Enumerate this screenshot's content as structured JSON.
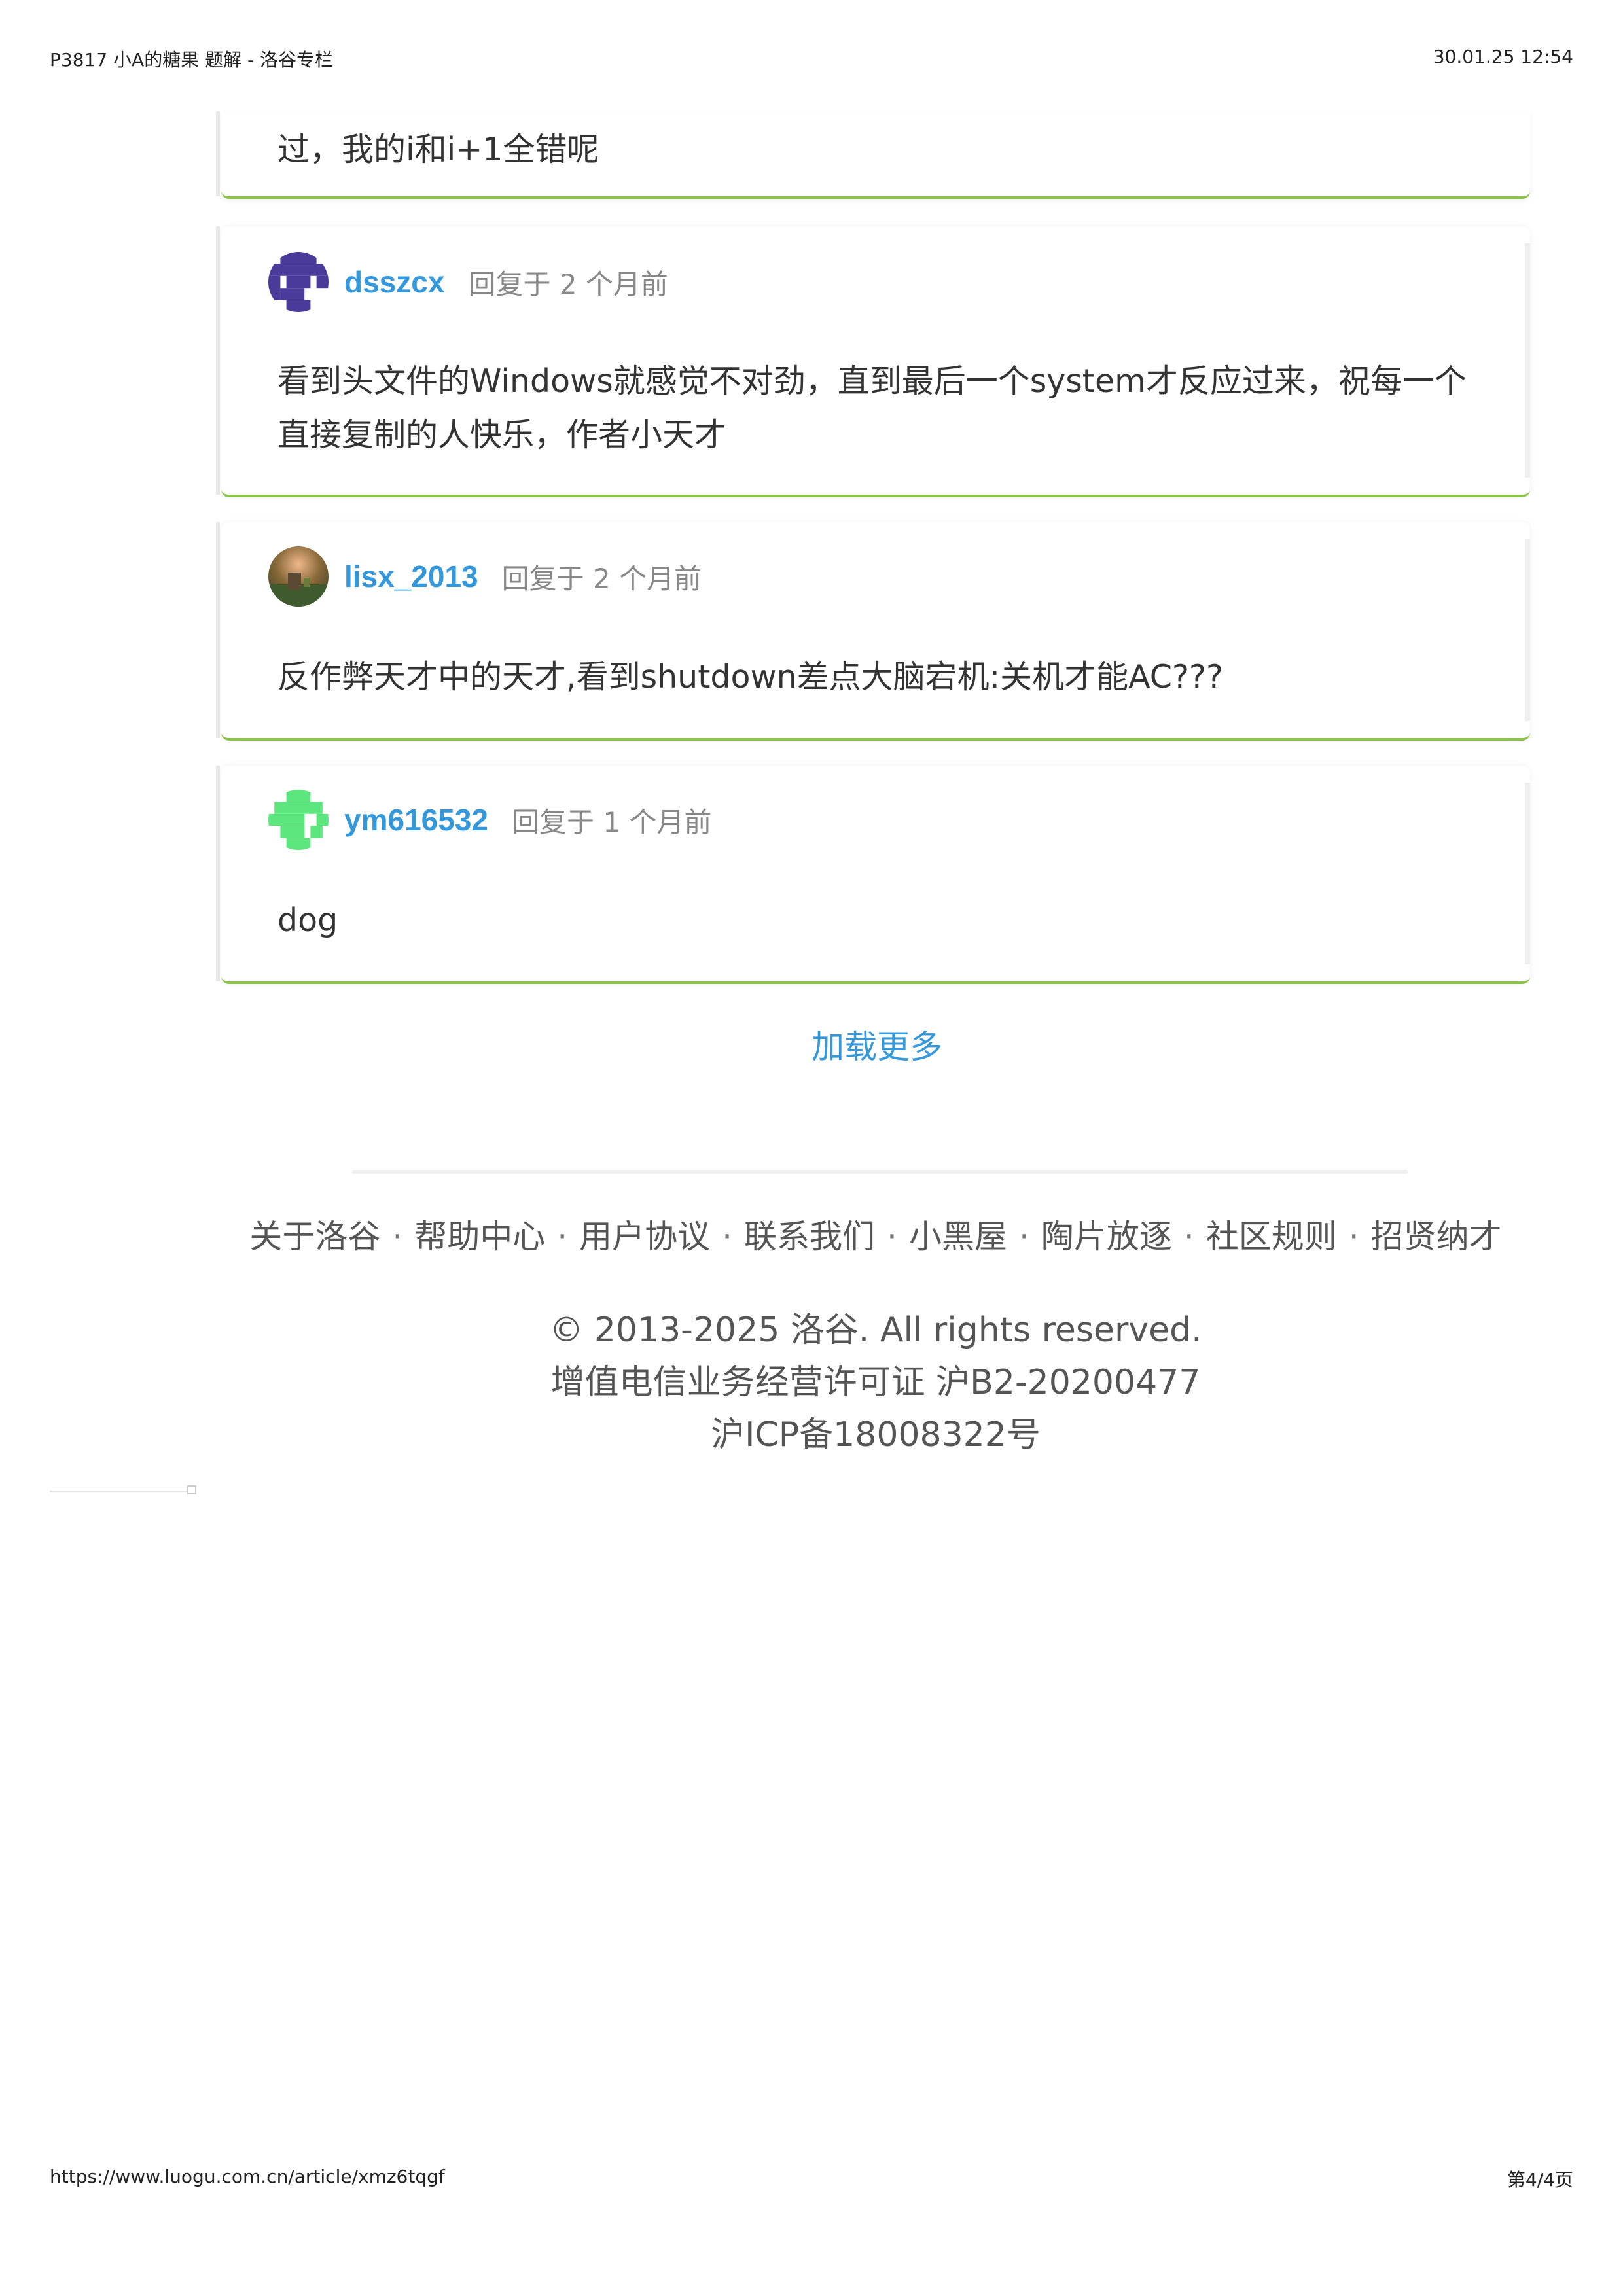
{
  "print_header": {
    "title": "P3817 小A的糖果 题解 - 洛谷专栏",
    "datetime": "30.01.25 12:54"
  },
  "print_footer": {
    "url": "https://www.luogu.com.cn/article/xmz6tqgf",
    "page": "第4/4页"
  },
  "comments": [
    {
      "text": "过，我的i和i+1全错呢"
    },
    {
      "user": "dsszcx",
      "meta": "回复于 2 个月前",
      "text": "看到头文件的Windows就感觉不对劲，直到最后一个system才反应过来，祝每一个直接复制的人快乐，作者小天才"
    },
    {
      "user": "lisx_2013",
      "meta": "回复于 2 个月前",
      "text": "反作弊天才中的天才,看到shutdown差点大脑宕机:关机才能AC???"
    },
    {
      "user": "ym616532",
      "meta": "回复于 1 个月前",
      "text": "dog"
    }
  ],
  "load_more": "加载更多",
  "footer_links": [
    "关于洛谷",
    "帮助中心",
    "用户协议",
    "联系我们",
    "小黑屋",
    "陶片放逐",
    "社区规则",
    "招贤纳才"
  ],
  "copyright": {
    "line1": "© 2013-2025 洛谷. All rights reserved.",
    "line2": "增值电信业务经营许可证 沪B2-20200477",
    "line3": "沪ICP备18008322号"
  },
  "colors": {
    "accent": "#3498db",
    "card_border": "#8bc34a",
    "dsszcx_avatar": "#4a3a9a",
    "ym616532_avatar": "#5ee67e"
  }
}
